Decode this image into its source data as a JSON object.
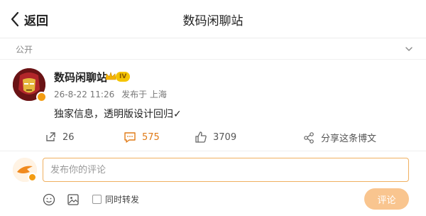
{
  "nav": {
    "back_label": "返回",
    "title": "数码闲聊站"
  },
  "visibility": {
    "label": "公开"
  },
  "post": {
    "author": "数码闲聊站",
    "level": "IV",
    "date": "26-8-22 11:26",
    "source": "发布于 上海",
    "text": "独家信息，透明版设计回归✓"
  },
  "actions": {
    "repost_count": "26",
    "comment_count": "575",
    "like_count": "3709",
    "share_label": "分享这条博文"
  },
  "comment": {
    "placeholder": "发布你的评论",
    "repost_label": "同时转发",
    "submit_label": "评论"
  },
  "colors": {
    "accent": "#e07a16",
    "submit_bg": "#f9c58f",
    "input_border": "#f0b060"
  },
  "icons": [
    "back-chevron-icon",
    "chevron-down-icon",
    "repost-icon",
    "comment-icon",
    "like-icon",
    "share-icon",
    "emoji-icon",
    "image-icon"
  ]
}
